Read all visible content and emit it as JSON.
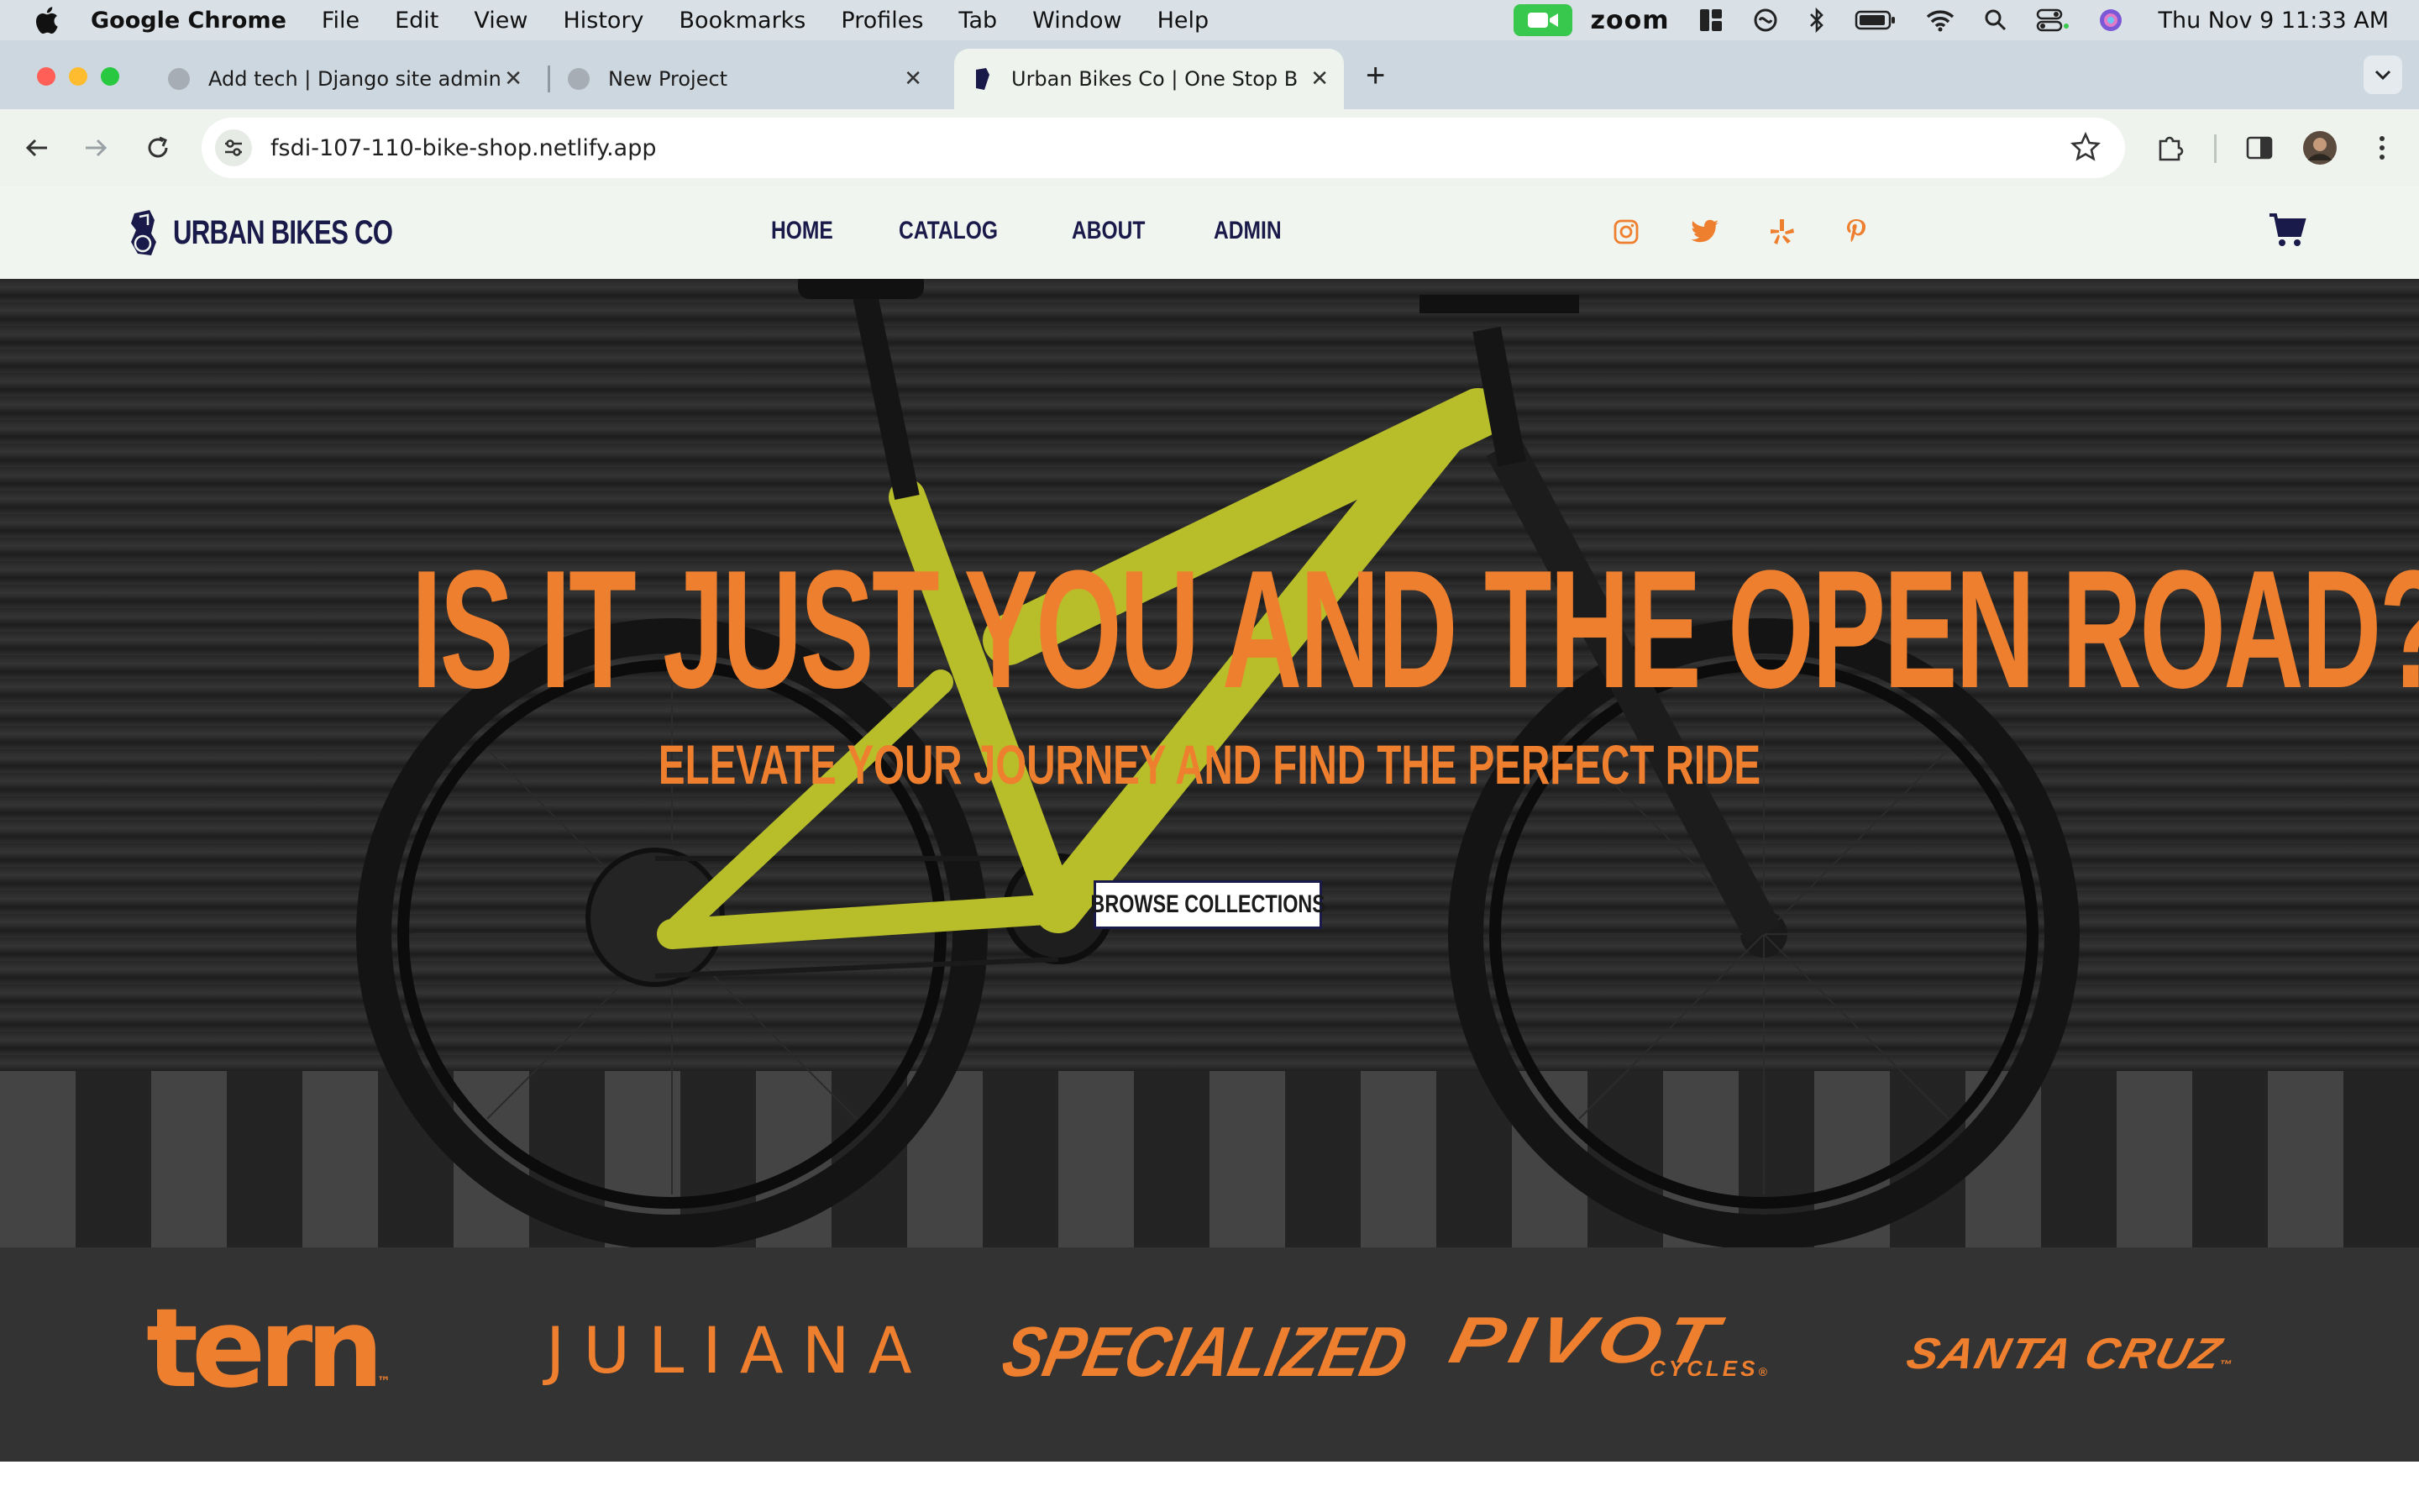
{
  "menubar": {
    "app": "Google Chrome",
    "items": [
      "File",
      "Edit",
      "View",
      "History",
      "Bookmarks",
      "Profiles",
      "Tab",
      "Window",
      "Help"
    ],
    "zoom": "zoom",
    "clock": "Thu Nov 9  11:33 AM"
  },
  "tabs": [
    {
      "title": "Add tech | Django site admin"
    },
    {
      "title": "New Project"
    },
    {
      "title": "Urban Bikes Co | One Stop Bi"
    }
  ],
  "omnibox": {
    "url": "fsdi-107-110-bike-shop.netlify.app"
  },
  "site": {
    "brand": "URBAN BIKES CO",
    "nav": [
      "HOME",
      "CATALOG",
      "ABOUT",
      "ADMIN"
    ],
    "social_icons": [
      "instagram-icon",
      "twitter-icon",
      "yelp-icon",
      "pinterest-icon"
    ],
    "accent_color": "#ee7f2f",
    "navy_color": "#1a1a4a"
  },
  "hero": {
    "title": "IS IT JUST YOU AND THE OPEN ROAD?",
    "subtitle": "ELEVATE YOUR JOURNEY AND FIND THE PERFECT RIDE",
    "button": "BROWSE COLLECTIONS"
  },
  "brands": {
    "tern": "tern",
    "tern_tm": "™",
    "juliana": "JULIANA",
    "specialized": "SPECIALIZED",
    "pivot": "PIVOT",
    "pivot_sub": "CYCLES",
    "pivot_reg": "®",
    "santacruz": "SANTA CRUZ",
    "santacruz_tm": "™"
  }
}
